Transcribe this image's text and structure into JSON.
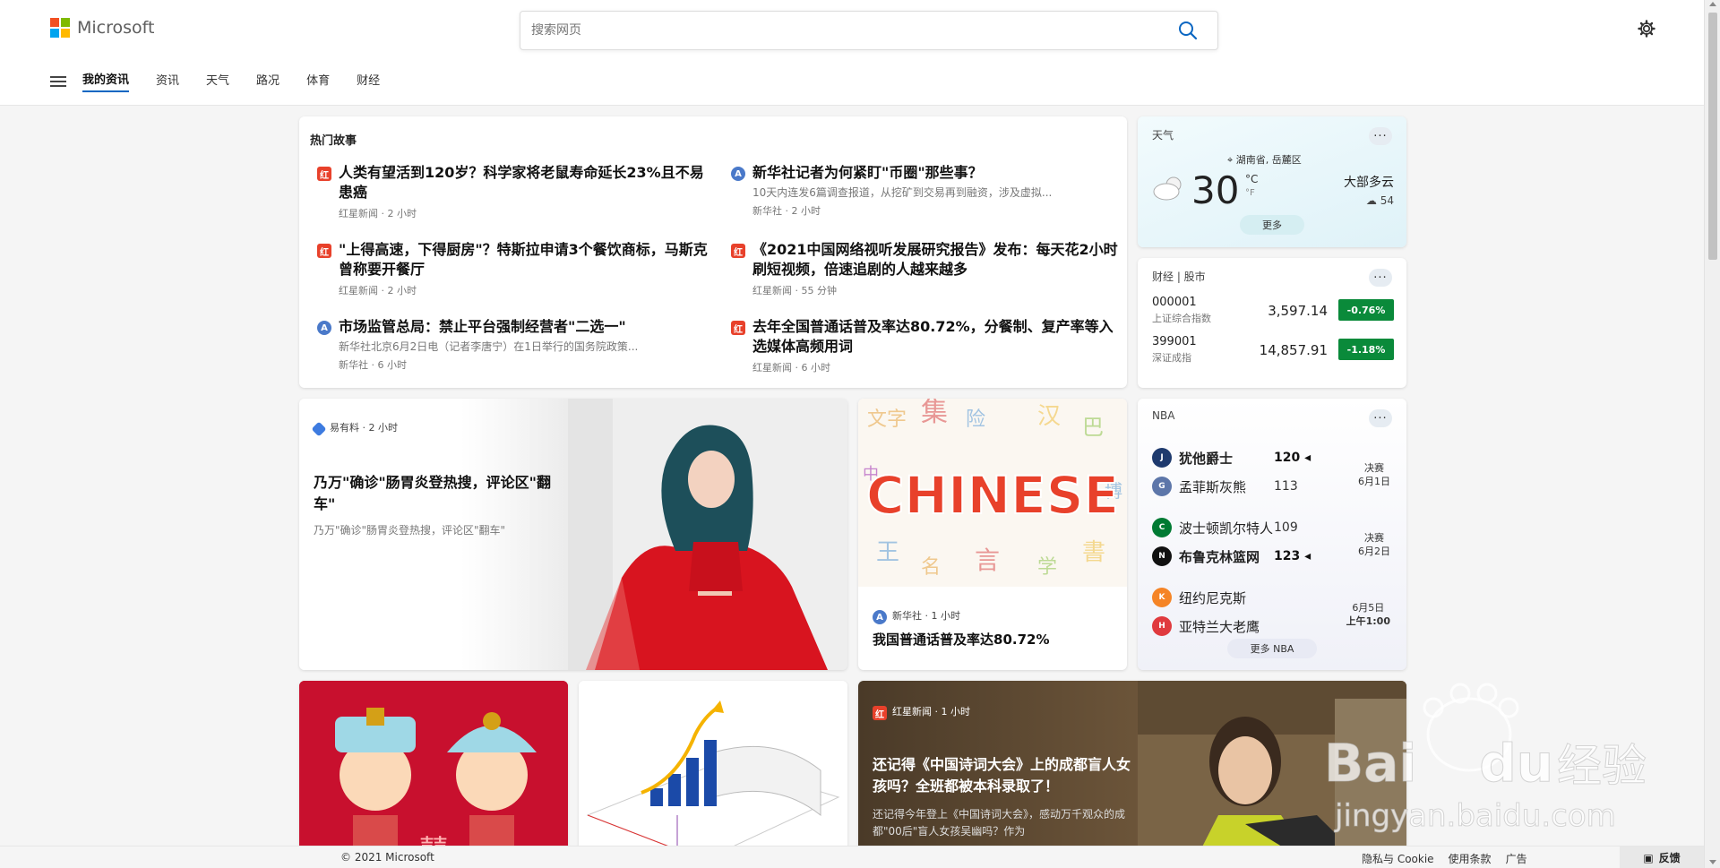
{
  "brand": {
    "name": "Microsoft",
    "colors": [
      "#f25022",
      "#7fba00",
      "#00a4ef",
      "#ffb900"
    ]
  },
  "search": {
    "placeholder": "搜索网页"
  },
  "nav": {
    "tabs": [
      {
        "label": "我的资讯",
        "active": true
      },
      {
        "label": "资讯"
      },
      {
        "label": "天气"
      },
      {
        "label": "路况"
      },
      {
        "label": "体育"
      },
      {
        "label": "财经"
      }
    ]
  },
  "top_stories": {
    "title": "热门故事",
    "items": [
      {
        "headline": "人类有望活到120岁？科学家将老鼠寿命延长23%且不易患癌",
        "summary": "",
        "source": "红星新闻",
        "time": "2 小时"
      },
      {
        "headline": "新华社记者为何紧盯\"币圈\"那些事？",
        "summary": "10天内连发6篇调查报道，从挖矿到交易再到融资，涉及虚拟...",
        "source": "新华社",
        "time": "2 小时"
      },
      {
        "headline": "\"上得高速，下得厨房\"？特斯拉申请3个餐饮商标，马斯克曾称要开餐厅",
        "summary": "",
        "source": "红星新闻",
        "time": "2 小时"
      },
      {
        "headline": "《2021中国网络视听发展研究报告》发布：每天花2小时刷短视频，倍速追剧的人越来越多",
        "summary": "",
        "source": "红星新闻",
        "time": "55 分钟"
      },
      {
        "headline": "市场监管总局：禁止平台强制经营者\"二选一\"",
        "summary": "新华社北京6月2日电（记者李唐宁）在1日举行的国务院政策...",
        "source": "新华社",
        "time": "6 小时"
      },
      {
        "headline": "去年全国普通话普及率达80.72%，分餐制、复产率等入选媒体高频用词",
        "summary": "",
        "source": "红星新闻",
        "time": "6 小时"
      }
    ]
  },
  "weather": {
    "label": "天气",
    "location": "湖南省, 岳麓区",
    "temp": "30",
    "unit_c": "°C",
    "unit_f": "°F",
    "condition": "大部多云",
    "aqi": "54",
    "more": "更多"
  },
  "finance": {
    "label": "财经 | 股市",
    "stocks": [
      {
        "code": "000001",
        "name": "上证综合指数",
        "value": "3,597.14",
        "change": "-0.76%"
      },
      {
        "code": "399001",
        "name": "深证成指",
        "value": "14,857.91",
        "change": "-1.18%"
      }
    ]
  },
  "feature": {
    "source": "易有料",
    "time": "2 小时",
    "title": "乃万\"确诊\"肠胃炎登热搜，评论区\"翻车\"",
    "summary": "乃万\"确诊\"肠胃炎登热搜，评论区\"翻车\""
  },
  "chinese_card": {
    "image_text": "CHINESE",
    "source": "新华社",
    "time": "1 小时",
    "title": "我国普通话普及率达80.72%"
  },
  "nba": {
    "label": "NBA",
    "games": [
      {
        "teams": [
          {
            "name": "犹他爵士",
            "score": "120",
            "winner": true
          },
          {
            "name": "孟菲斯灰熊",
            "score": "113",
            "winner": false
          }
        ],
        "stage": "决赛",
        "date": "6月1日"
      },
      {
        "teams": [
          {
            "name": "波士顿凯尔特人",
            "score": "109",
            "winner": false
          },
          {
            "name": "布鲁克林篮网",
            "score": "123",
            "winner": true
          }
        ],
        "stage": "决赛",
        "date": "6月2日"
      },
      {
        "teams": [
          {
            "name": "纽约尼克斯",
            "score": ""
          },
          {
            "name": "亚特兰大老鹰",
            "score": ""
          }
        ],
        "stage": "6月5日",
        "date": "上午1:00"
      }
    ],
    "more": "更多 NBA"
  },
  "poet_card": {
    "source": "红星新闻",
    "time": "1 小时",
    "title": "还记得《中国诗词大会》上的成都盲人女孩吗？全班都被本科录取了！",
    "summary": "还记得今年登上《中国诗词大会》，感动万千观众的成都\"00后\"盲人女孩吴幽吗？作为"
  },
  "wedding_card": {
    "glyph": "囍"
  },
  "footer": {
    "copyright": "© 2021 Microsoft",
    "links": [
      "隐私与 Cookie",
      "使用条款",
      "广告"
    ],
    "feedback": "反馈"
  },
  "watermark": {
    "brand": "Bai",
    "brand2": "du",
    "cn": "经验",
    "url": "jingyan.baidu.com"
  }
}
